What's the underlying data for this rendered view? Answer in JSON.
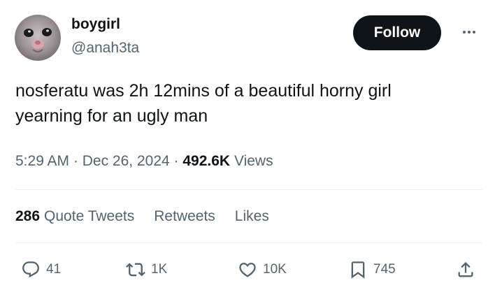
{
  "author": {
    "display_name": "boygirl",
    "handle": "@anah3ta",
    "avatar": "cat-face-photo"
  },
  "follow_label": "Follow",
  "more_icon": "more-horizontal-icon",
  "tweet": {
    "text_line1": "nosferatu was 2h 12mins of a beautiful horny girl",
    "text_line2": "yearning for an ugly man",
    "time": "5:29 AM",
    "separator": "·",
    "date": "Dec 26, 2024",
    "views_count": "492.6K",
    "views_label": "Views"
  },
  "stats": {
    "quote_count": "286",
    "quote_label": "Quote Tweets",
    "retweets_label": "Retweets",
    "likes_label": "Likes"
  },
  "actions": {
    "reply": {
      "icon": "reply-icon",
      "count": "41"
    },
    "retweet": {
      "icon": "retweet-icon",
      "count": "1K"
    },
    "like": {
      "icon": "heart-icon",
      "count": "10K"
    },
    "bookmark": {
      "icon": "bookmark-icon",
      "count": "745"
    },
    "share": {
      "icon": "share-icon"
    }
  },
  "colors": {
    "text_primary": "#0f1419",
    "text_secondary": "#536471",
    "follow_button_bg": "#0f1419",
    "divider": "#eff3f4"
  }
}
